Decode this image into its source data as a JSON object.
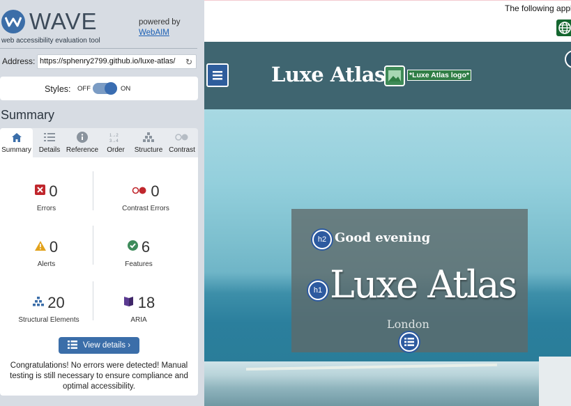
{
  "wave": {
    "logo_word": "WAVE",
    "tagline": "web accessibility evaluation tool",
    "powered_by": "powered by",
    "webaim_link": "WebAIM",
    "address_label": "Address:",
    "address_value": "https://sphenry2799.github.io/luxe-atlas/",
    "styles_label": "Styles:",
    "styles_off": "OFF",
    "styles_on": "ON",
    "summary_heading": "Summary",
    "tabs": [
      {
        "label": "Summary",
        "icon": "home-icon"
      },
      {
        "label": "Details",
        "icon": "list-icon"
      },
      {
        "label": "Reference",
        "icon": "info-icon"
      },
      {
        "label": "Order",
        "icon": "order-icon"
      },
      {
        "label": "Structure",
        "icon": "structure-icon"
      },
      {
        "label": "Contrast",
        "icon": "contrast-icon"
      }
    ],
    "stats": {
      "errors": {
        "count": "0",
        "label": "Errors"
      },
      "contrast_errors": {
        "count": "0",
        "label": "Contrast Errors"
      },
      "alerts": {
        "count": "0",
        "label": "Alerts"
      },
      "features": {
        "count": "6",
        "label": "Features"
      },
      "structural": {
        "count": "20",
        "label": "Structural Elements"
      },
      "aria": {
        "count": "18",
        "label": "ARIA"
      }
    },
    "view_details": "View details ›",
    "congrats": "Congratulations! No errors were detected! Manual testing is still necessary to ensure compliance and optimal accessibility.",
    "colors": {
      "accent": "#3b6ea9",
      "error": "#c0272d",
      "alert": "#e2a21b",
      "feature": "#3d8b5a",
      "aria": "#5b3a91"
    }
  },
  "site": {
    "following_text": "The following appli",
    "brand_title": "Luxe Atlas",
    "logo_alt": "*Luxe Atlas logo*",
    "h2_badge": "h2",
    "greeting": "Good evening",
    "h1_badge": "h1",
    "hero_title": "Luxe Atlas",
    "city": "London",
    "colors": {
      "header": "#3f6570",
      "badge": "#2d5aa0"
    }
  }
}
